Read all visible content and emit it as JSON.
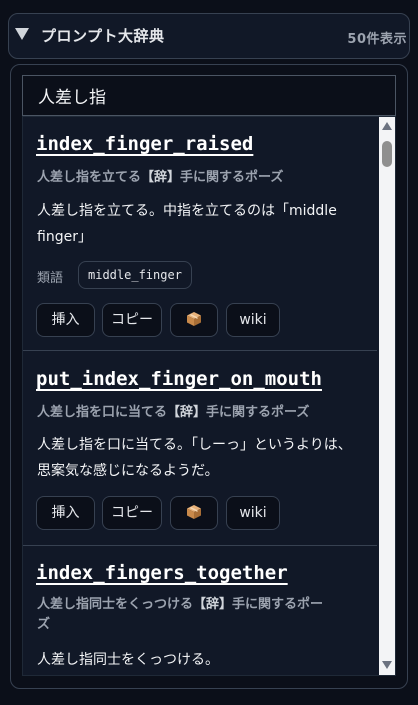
{
  "header": {
    "title": "プロンプト大辞典",
    "count": "50件表示"
  },
  "search": {
    "value": "人差し指"
  },
  "results": [
    {
      "tag": "index_finger_raised",
      "name": "人差し指を立てる",
      "tag_badge": "【辞】",
      "category": "手に関するポーズ",
      "desc_line1": "人差し指を立てる。中指を立てるのは「middle",
      "desc_line2": "finger」",
      "synonym_label": "類語",
      "synonym": "middle_finger",
      "buttons": {
        "insert": "挿入",
        "copy": "コピー",
        "wiki": "wiki"
      }
    },
    {
      "tag": "put_index_finger_on_mouth",
      "name": "人差し指を口に当てる",
      "tag_badge": "【辞】",
      "category": "手に関するポーズ",
      "desc_line1": "人差し指を口に当てる。「しーっ」というよりは、",
      "desc_line2": "思案気な感じになるようだ。",
      "buttons": {
        "insert": "挿入",
        "copy": "コピー",
        "wiki": "wiki"
      }
    },
    {
      "tag": "index_fingers_together",
      "name": "人差し指同士をくっつける",
      "tag_badge": "【辞】",
      "category_line1": "手に関するポー",
      "category_line2": "ズ",
      "desc_line1": "人差し指同士をくっつける。"
    }
  ],
  "icons": {
    "collapse": "triangle-down-icon",
    "package": "package-icon"
  },
  "colors": {
    "background": "#0b0f19",
    "panel": "#111827",
    "border": "#374151"
  }
}
